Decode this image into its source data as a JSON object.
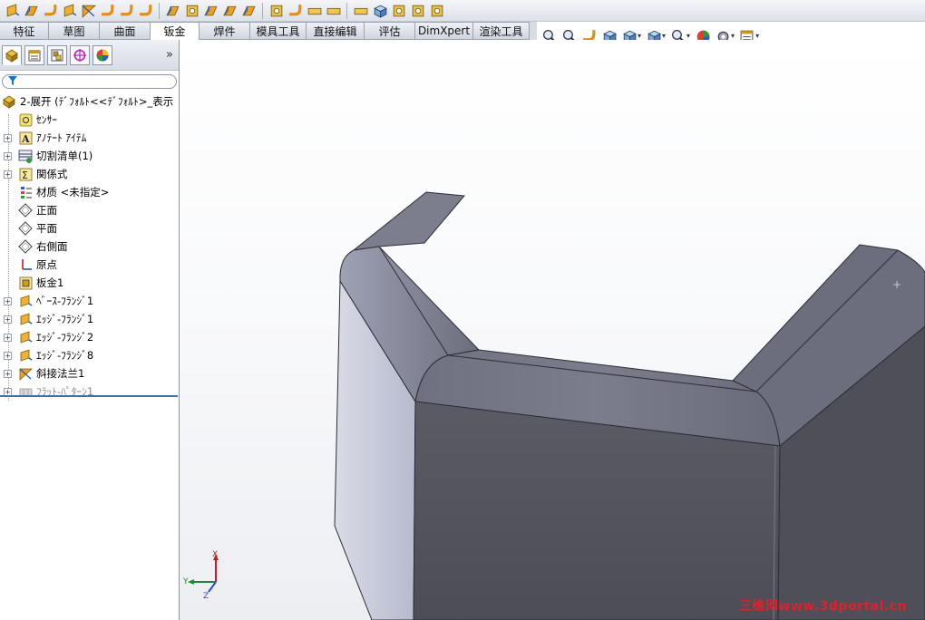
{
  "colors": {
    "accent": "#3f6db4",
    "model_face_dark": "#55565f",
    "model_face_light": "#c3c6d6",
    "watermark": "#e0202a"
  },
  "toolbar": {
    "icons": [
      "base-flange-icon",
      "convert-to-sheet-metal-icon",
      "lofted-bend-icon",
      "edge-flange-icon",
      "miter-flange-icon",
      "hem-icon",
      "jog-icon",
      "sketched-bend-icon",
      "cross-break-icon",
      "forming-tool-icon",
      "closed-corner-icon",
      "weld-corner-icon",
      "break-corner-icon",
      "rip-icon",
      "insert-bends-icon",
      "unfold-icon",
      "fold-icon",
      "flatten-icon",
      "no-bends-icon",
      "extruded-cut-icon",
      "simple-hole-icon",
      "vent-icon"
    ]
  },
  "tabs": [
    {
      "label": "特征"
    },
    {
      "label": "草图"
    },
    {
      "label": "曲面"
    },
    {
      "label": "钣金",
      "active": true
    },
    {
      "label": "焊件"
    },
    {
      "label": "模具工具"
    },
    {
      "label": "直接编辑"
    },
    {
      "label": "评估"
    },
    {
      "label": "DimXpert"
    },
    {
      "label": "渲染工具"
    }
  ],
  "viewbar": {
    "icons": [
      "zoom-to-fit-icon",
      "zoom-to-area-icon",
      "previous-view-icon",
      "section-view-icon",
      "view-orientation-icon",
      "display-style-icon",
      "hide-show-items-icon",
      "edit-appearance-icon",
      "apply-scene-icon",
      "view-settings-icon"
    ]
  },
  "feature_manager": {
    "tabs": [
      "featuremanager-tab-icon",
      "propertymanager-tab-icon",
      "configurationmanager-tab-icon",
      "dimxpertmanager-tab-icon",
      "displaymanager-tab-icon"
    ],
    "expand_glyph": "»",
    "root": "2-展开  (ﾃﾞﾌｫﾙﾄ<<ﾃﾞﾌｫﾙﾄ>_表示",
    "items": [
      {
        "label": "ｾﾝｻｰ",
        "icon": "sensor-icon",
        "expandable": false
      },
      {
        "label": "ｱﾉﾃｰﾄ ｱｲﾃﾑ",
        "icon": "annotations-icon",
        "expandable": true
      },
      {
        "label": "切割清单(1)",
        "icon": "cut-list-icon",
        "expandable": true
      },
      {
        "label": "関係式",
        "icon": "equations-icon",
        "expandable": true
      },
      {
        "label": "材质 <未指定>",
        "icon": "material-icon",
        "expandable": false
      },
      {
        "label": "正面",
        "icon": "plane-icon",
        "expandable": false
      },
      {
        "label": "平面",
        "icon": "plane-icon",
        "expandable": false
      },
      {
        "label": "右側面",
        "icon": "plane-icon",
        "expandable": false
      },
      {
        "label": "原点",
        "icon": "origin-icon",
        "expandable": false
      },
      {
        "label": "板金1",
        "icon": "sheet-metal-icon",
        "expandable": false
      },
      {
        "label": "ﾍﾞｰｽ-ﾌﾗﾝｼﾞ1",
        "icon": "base-flange-icon",
        "expandable": true
      },
      {
        "label": "ｴｯｼﾞ-ﾌﾗﾝｼﾞ1",
        "icon": "edge-flange-icon",
        "expandable": true
      },
      {
        "label": "ｴｯｼﾞ-ﾌﾗﾝｼﾞ2",
        "icon": "edge-flange-icon",
        "expandable": true
      },
      {
        "label": "ｴｯｼﾞ-ﾌﾗﾝｼﾞ8",
        "icon": "edge-flange-icon",
        "expandable": true
      },
      {
        "label": "斜接法兰1",
        "icon": "miter-flange-icon",
        "expandable": true
      },
      {
        "label": "ﾌﾗｯﾄ-ﾊﾟﾀｰﾝ1",
        "icon": "flat-pattern-icon",
        "expandable": true,
        "suppressed": true
      }
    ]
  },
  "triad": {
    "x": "X",
    "y": "Y",
    "z": "Z"
  },
  "watermark": "三维网www.3dportal.cn"
}
